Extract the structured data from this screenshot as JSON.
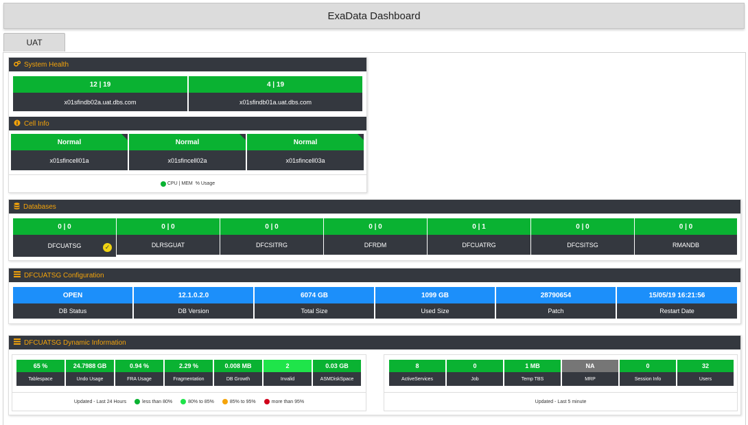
{
  "header": {
    "title": "ExaData Dashboard"
  },
  "tabs": [
    {
      "label": "UAT"
    }
  ],
  "system_health": {
    "title": "System Health",
    "nodes": [
      {
        "value": "12 | 19",
        "host": "x01sfindb02a.uat.dbs.com"
      },
      {
        "value": "4 | 19",
        "host": "x01sfindb01a.uat.dbs.com"
      }
    ]
  },
  "cell_info": {
    "title": "Cell Info",
    "cells": [
      {
        "status": "Normal",
        "name": "x01sfincell01a"
      },
      {
        "status": "Normal",
        "name": "x01sfincell02a"
      },
      {
        "status": "Normal",
        "name": "x01sfincell03a"
      }
    ],
    "legend": {
      "cpu_mem": "CPU | MEM",
      "usage": "% Usage"
    }
  },
  "databases": {
    "title": "Databases",
    "items": [
      {
        "value": "0 | 0",
        "name": "DFCUATSG",
        "selected": true
      },
      {
        "value": "0 | 0",
        "name": "DLRSGUAT"
      },
      {
        "value": "0 | 0",
        "name": "DFCSITRG"
      },
      {
        "value": "0 | 0",
        "name": "DFRDM"
      },
      {
        "value": "0 | 1",
        "name": "DFCUATRG"
      },
      {
        "value": "0 | 0",
        "name": "DFCSITSG"
      },
      {
        "value": "0 | 0",
        "name": "RMANDB"
      }
    ]
  },
  "config": {
    "title": "DFCUATSG Configuration",
    "items": [
      {
        "value": "OPEN",
        "label": "DB Status"
      },
      {
        "value": "12.1.0.2.0",
        "label": "DB Version"
      },
      {
        "value": "6074 GB",
        "label": "Total Size"
      },
      {
        "value": "1099 GB",
        "label": "Used Size"
      },
      {
        "value": "28790654",
        "label": "Patch"
      },
      {
        "value": "15/05/19 16:21:56",
        "label": "Restart Date"
      }
    ]
  },
  "dynamic": {
    "title": "DFCUATSG Dynamic Information",
    "left": [
      {
        "value": "65 %",
        "label": "Tablespace"
      },
      {
        "value": "24.7988 GB",
        "label": "Undo Usage"
      },
      {
        "value": "0.94 %",
        "label": "FRA Usage"
      },
      {
        "value": "2.29 %",
        "label": "Fragmentation"
      },
      {
        "value": "0.008 MB",
        "label": "DB Growth"
      },
      {
        "value": "2",
        "label": "Invalid"
      },
      {
        "value": "0.03 GB",
        "label": "ASMDiskSpace"
      }
    ],
    "left_footer": {
      "updated": "Updated - Last 24 Hours",
      "legend": [
        "less than 80%",
        "80% to 85%",
        "85% to 95%",
        "more than 95%"
      ]
    },
    "right": [
      {
        "value": "8",
        "label": "ActiveServices"
      },
      {
        "value": "0",
        "label": "Job"
      },
      {
        "value": "1 MB",
        "label": "Temp TBS"
      },
      {
        "value": "NA",
        "label": "MRP"
      },
      {
        "value": "0",
        "label": "Session Info"
      },
      {
        "value": "32",
        "label": "Users"
      }
    ],
    "right_footer": {
      "updated": "Updated - Last 5 minute"
    }
  },
  "colors": {
    "green": "#0ab232",
    "blue": "#1c8ffa",
    "dark": "#34383f",
    "accent": "#f5a40a",
    "legend": [
      "#0ab232",
      "#1fe44a",
      "#f5a40a",
      "#d0021b"
    ]
  }
}
